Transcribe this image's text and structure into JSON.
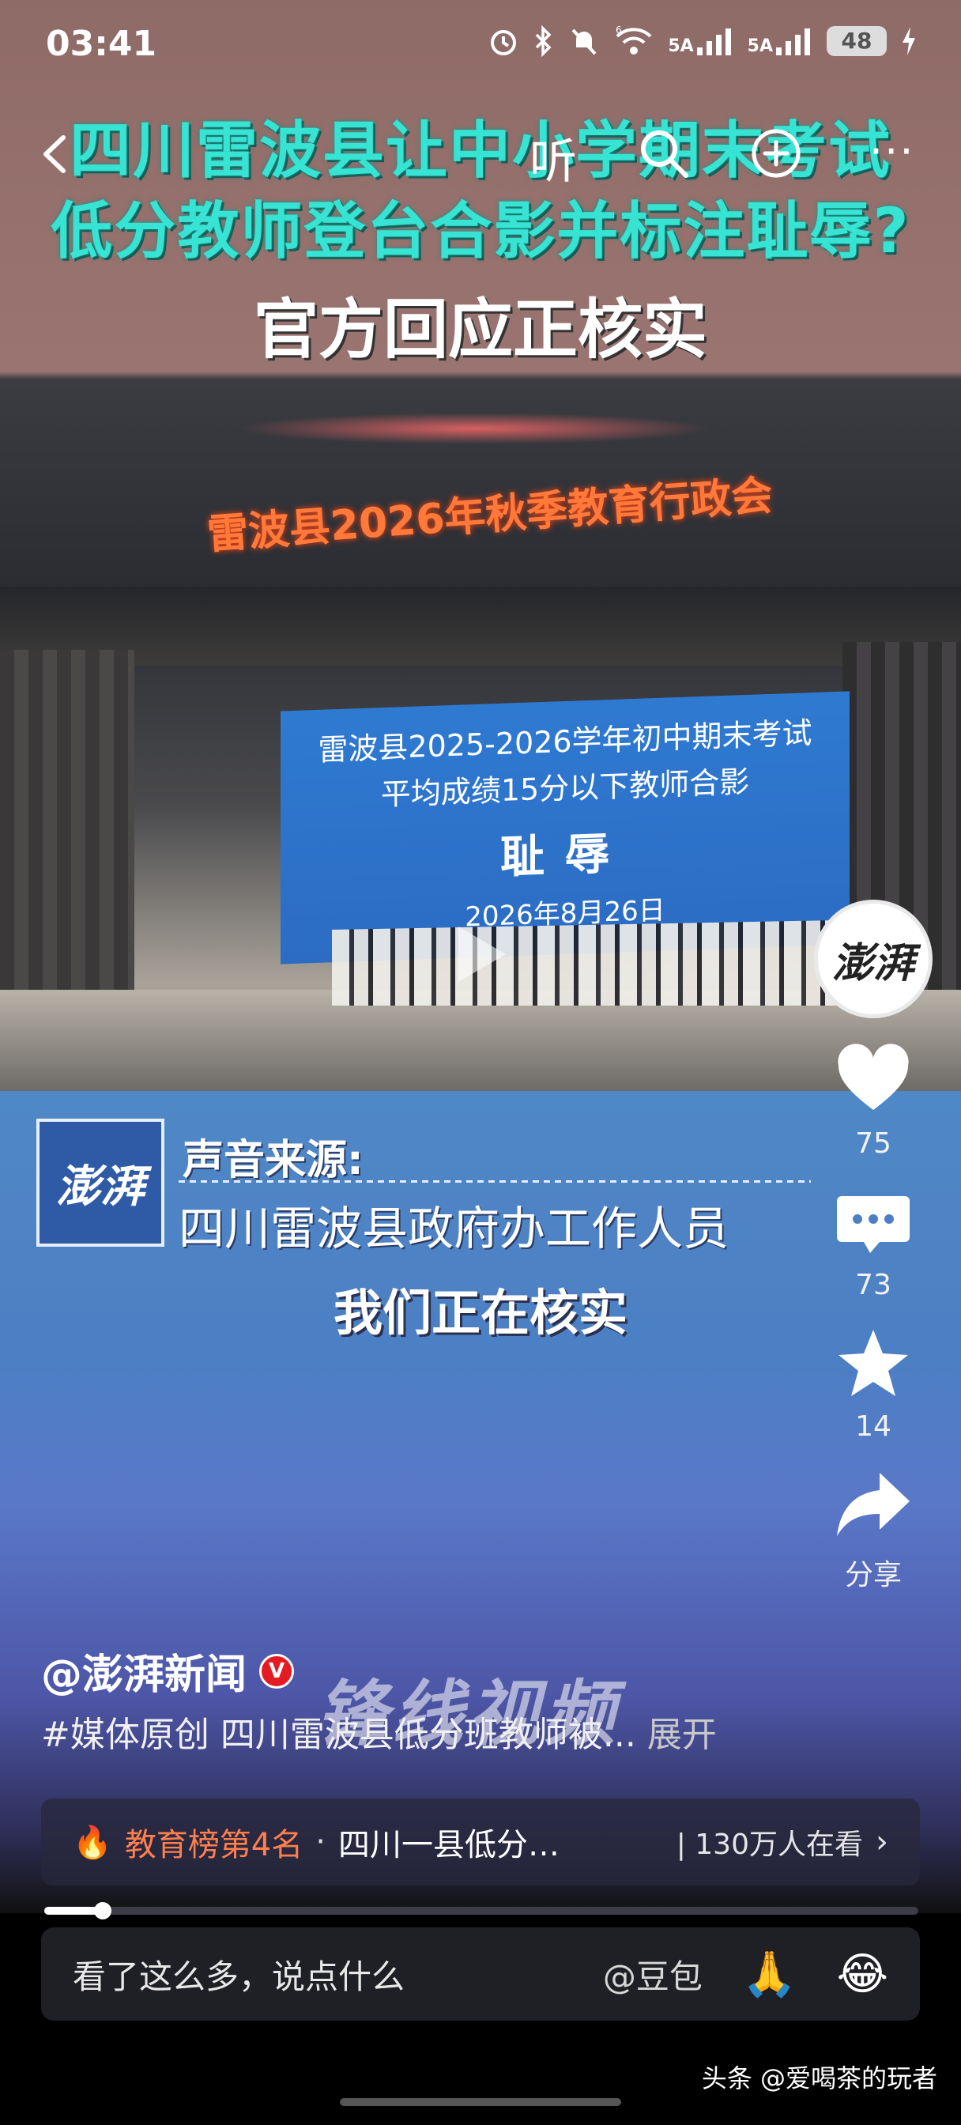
{
  "status_bar": {
    "time": "03:41",
    "signal_1": "5A",
    "signal_2": "5A",
    "battery": "48",
    "wifi_label": "6"
  },
  "video": {
    "headline_line1": "四川雷波县让中小学期末考试",
    "headline_line2": "低分教师登台合影并标注耻辱?",
    "headline_line3": "官方回应正核实",
    "stage_banner": "雷波县2026年秋季教育行政会",
    "screen_line1": "雷波县2025-2026学年初中期末考试",
    "screen_line2": "平均成绩15分以下教师合影",
    "screen_line3": "耻辱",
    "screen_line4": "2026年8月26日",
    "source_logo": "澎湃",
    "source_label": "声音来源:",
    "source_name": "四川雷波县政府办工作人员",
    "subtitle": "我们正在核实",
    "watermark": "锋线视频"
  },
  "top_nav": {
    "listen_label": "听",
    "more_label": "···"
  },
  "sidebar": {
    "avatar_text": "澎湃",
    "like_count": "75",
    "comment_count": "73",
    "favorite_count": "14",
    "share_label": "分享"
  },
  "post": {
    "author": "@澎湃新闻",
    "verified_mark": "V",
    "description": "#媒体原创 四川雷波县低分班教师被...",
    "expand_label": "展开"
  },
  "rank_bar": {
    "rank_label": "教育榜第4名",
    "separator": "·",
    "topic": "四川一县低分…",
    "watching": "| 130万人在看"
  },
  "playback": {
    "progress": 0.067
  },
  "comment_bar": {
    "placeholder": "看了这么多，说点什么",
    "mention": "@豆包",
    "emoji_1": "🙏",
    "emoji_2": "😂"
  },
  "footer": {
    "credit": "头条 @爱喝茶的玩者"
  },
  "colors": {
    "headline_cyan": "#37e3d2",
    "rank_orange": "#ff7f4f",
    "verified_red": "#e51b23"
  }
}
